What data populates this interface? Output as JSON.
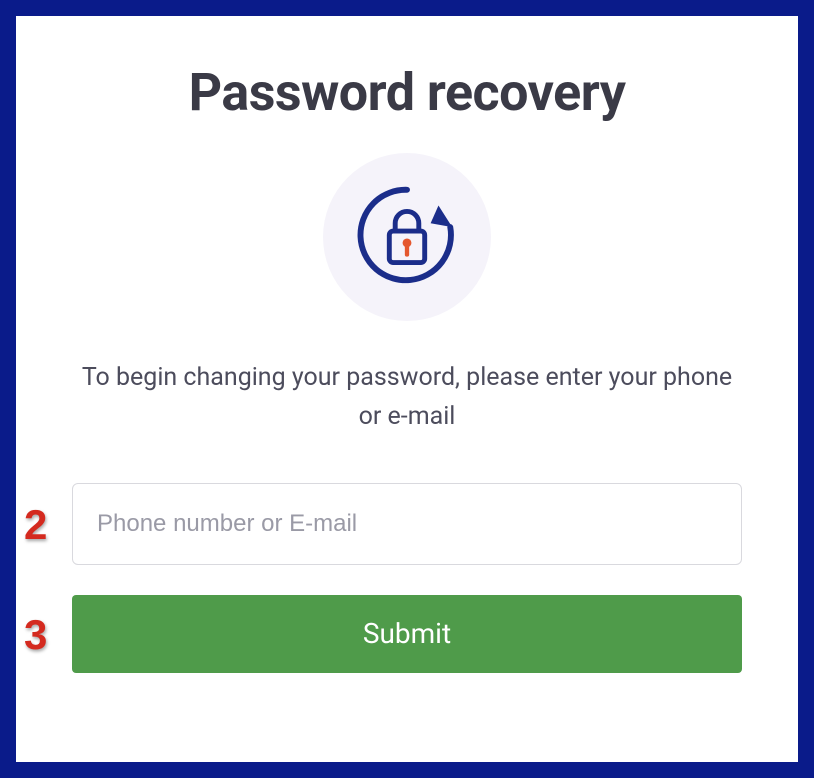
{
  "title": "Password recovery",
  "instructions": "To begin changing your password, please enter your phone or e-mail",
  "input": {
    "placeholder": "Phone number or E-mail",
    "value": ""
  },
  "submit_label": "Submit",
  "annotations": {
    "input_marker": "2",
    "submit_marker": "3"
  },
  "icon_name": "password-reset-lock-icon",
  "colors": {
    "frame": "#0a1b8a",
    "accent": "#4f9b4a",
    "icon_primary": "#1b2d8a",
    "icon_keyhole": "#e4572e",
    "annotation": "#d42a1f"
  }
}
